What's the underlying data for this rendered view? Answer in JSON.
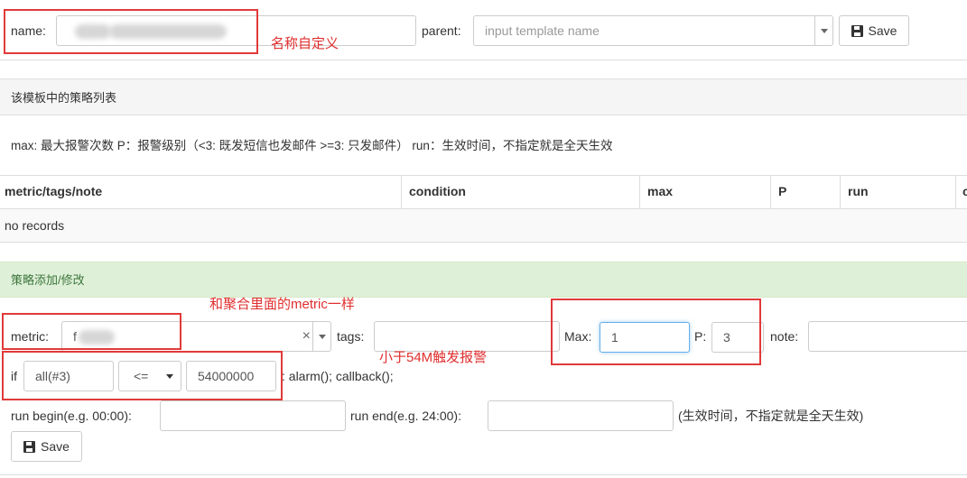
{
  "template_form": {
    "name_label": "name:",
    "parent_label": "parent:",
    "parent_placeholder": "input template name",
    "save_label": "Save"
  },
  "strategy_list": {
    "heading": "该模板中的策略列表",
    "legend": "max: 最大报警次数 P：报警级别（<3: 既发短信也发邮件 >=3: 只发邮件） run：生效时间，不指定就是全天生效",
    "columns": [
      "metric/tags/note",
      "condition",
      "max",
      "P",
      "run",
      "c"
    ],
    "empty_text": "no records"
  },
  "strategy_form": {
    "heading": "策略添加/修改",
    "metric_label": "metric:",
    "metric_value": "f",
    "clear_symbol": "×",
    "tags_label": "tags:",
    "max_label": "Max:",
    "max_value": "1",
    "p_label": "P:",
    "p_value": "3",
    "note_label": "note:",
    "if_label": "if",
    "func_value": "all(#3)",
    "operator_value": "<=",
    "threshold_value": "54000000",
    "action_text": ": alarm(); callback();",
    "run_begin_label": "run begin(e.g. 00:00):",
    "run_end_label": "run end(e.g. 24:00):",
    "run_hint": "(生效时间，不指定就是全天生效)",
    "save_label": "Save"
  },
  "annotations": {
    "name_note": "名称自定义",
    "metric_note": "和聚合里面的metric一样",
    "threshold_note": "小于54M触发报警"
  },
  "colors": {
    "annotation_red": "#e03a3a",
    "panel_gray": "#f5f5f5",
    "panel_green": "#dff0d8",
    "focus_blue": "#66afe9"
  }
}
